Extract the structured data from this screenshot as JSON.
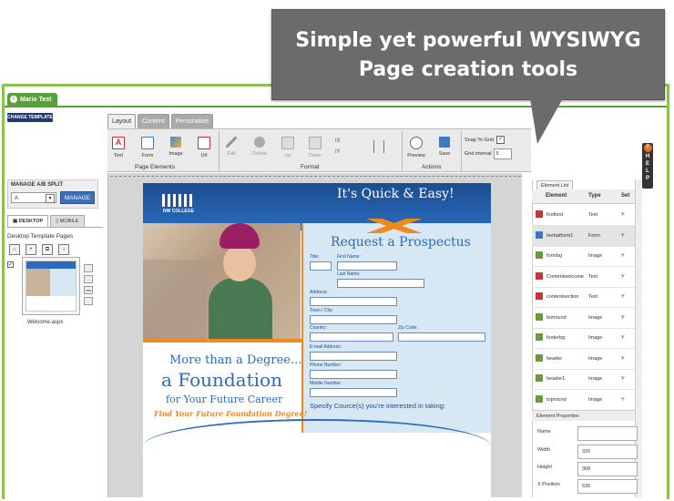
{
  "callout": {
    "line1": "Simple yet powerful WYSIWYG",
    "line2": "Page creation tools"
  },
  "user_tab": {
    "label": "Mario Test"
  },
  "change_template": "CHANGE TEMPLATE",
  "tabs": [
    {
      "label": "Layout",
      "active": true
    },
    {
      "label": "Content",
      "active": false
    },
    {
      "label": "Personalize",
      "active": false
    }
  ],
  "ribbon": {
    "page_elements": {
      "label": "Page Elements",
      "buttons": [
        "Text",
        "Form",
        "Image",
        "Url"
      ]
    },
    "format": {
      "label": "Format",
      "buttons": [
        "Edit",
        "Delete",
        "Up",
        "Down"
      ],
      "align_x": "IX",
      "align_y": "IY"
    },
    "actions": {
      "label": "Actions",
      "buttons": [
        "Preview",
        "Save"
      ]
    },
    "snap_to_grid": {
      "label": "Snap To Grid",
      "checked": true
    },
    "grid_interval": {
      "label": "Grid interval",
      "value": "5"
    }
  },
  "help": {
    "letters": [
      "H",
      "E",
      "L",
      "P"
    ]
  },
  "ab_split": {
    "title": "MANAGE A/B SPLIT",
    "selected": "A",
    "button": "MANAGE"
  },
  "device_tabs": [
    {
      "label": "DESKTOP",
      "active": true
    },
    {
      "label": "MOBILE",
      "active": false
    }
  ],
  "desktop_pages": {
    "title": "Desktop Template Pages",
    "page_name": "Welcome.aspx",
    "side_tools": [
      "css"
    ]
  },
  "canvas": {
    "tagline": "It's Quick & Easy!",
    "logo_text": "NW COLLEGE",
    "form_title": "Request a Prospectus",
    "fields": {
      "title": "Title:",
      "first_name": "First Name:",
      "last_name": "Last Name:",
      "address": "Address:",
      "town": "Town / City:",
      "country": "Country:",
      "zip": "Zip Code:",
      "email": "E-mail Address:",
      "phone": "Phone Number:",
      "mobile": "Mobile Number:"
    },
    "specify": "Specify Cource(s) you're interested in taking:",
    "more": "More than a Degree...",
    "foundation": "a Foundation",
    "career": "for Your Future Career",
    "find": "Find Your Future Foundation Degree!"
  },
  "element_list": {
    "tab": "Element List",
    "headers": {
      "element": "Element",
      "type": "Type",
      "set": "Set"
    },
    "rows": [
      {
        "element": "foottext",
        "type": "Text",
        "set": "Y"
      },
      {
        "element": "herbalform1",
        "type": "Form",
        "set": "Y"
      },
      {
        "element": "formbg",
        "type": "Image",
        "set": "Y"
      },
      {
        "element": "Contentwelcome",
        "type": "Text",
        "set": "Y"
      },
      {
        "element": "contentsection",
        "type": "Text",
        "set": "Y"
      },
      {
        "element": "botround",
        "type": "Image",
        "set": "Y"
      },
      {
        "element": "footerbg",
        "type": "Image",
        "set": "Y"
      },
      {
        "element": "header",
        "type": "Image",
        "set": "Y"
      },
      {
        "element": "header1",
        "type": "Image",
        "set": "Y"
      },
      {
        "element": "topround",
        "type": "Image",
        "set": "Y"
      }
    ]
  },
  "element_properties": {
    "title": "Element Properties",
    "name": {
      "label": "Name",
      "value": ""
    },
    "width": {
      "label": "Width",
      "value": "320"
    },
    "height": {
      "label": "Height",
      "value": "368"
    },
    "x_position": {
      "label": "X Position",
      "value": "635"
    }
  },
  "colors": {
    "frame_green": "#8cc150",
    "accent_orange": "#f0891e",
    "brand_blue": "#2a6bbf",
    "callout_grey": "#6b6b6b"
  }
}
